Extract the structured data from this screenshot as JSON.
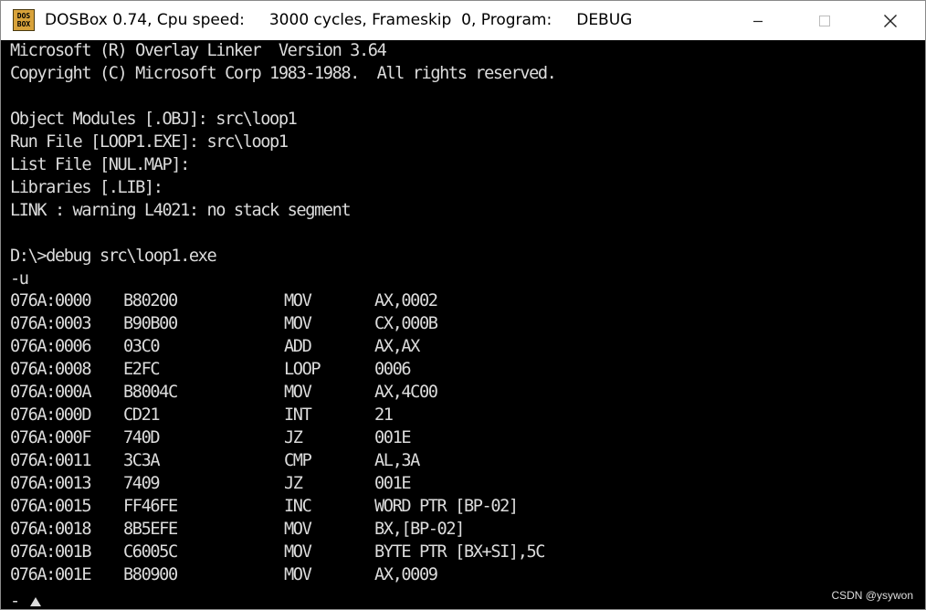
{
  "window": {
    "title": "DOSBox 0.74, Cpu speed:     3000 cycles, Frameskip  0, Program:     DEBUG",
    "icon": {
      "name": "dosbox-icon",
      "top": "DOS",
      "bottom": "BOX"
    },
    "controls": [
      "minimize",
      "maximize",
      "close"
    ]
  },
  "console": {
    "header_lines": [
      "Microsoft (R) Overlay Linker  Version 3.64",
      "Copyright (C) Microsoft Corp 1983-1988.  All rights reserved.",
      "",
      "Object Modules [.OBJ]: src\\loop1",
      "Run File [LOOP1.EXE]: src\\loop1",
      "List File [NUL.MAP]:",
      "Libraries [.LIB]:",
      "LINK : warning L4021: no stack segment",
      "",
      "D:\\>debug src\\loop1.exe",
      "-u"
    ],
    "disassembly": [
      {
        "addr": "076A:0000",
        "bytes": "B80200",
        "mnemonic": "MOV",
        "operands": "AX,0002"
      },
      {
        "addr": "076A:0003",
        "bytes": "B90B00",
        "mnemonic": "MOV",
        "operands": "CX,000B"
      },
      {
        "addr": "076A:0006",
        "bytes": "03C0",
        "mnemonic": "ADD",
        "operands": "AX,AX"
      },
      {
        "addr": "076A:0008",
        "bytes": "E2FC",
        "mnemonic": "LOOP",
        "operands": "0006"
      },
      {
        "addr": "076A:000A",
        "bytes": "B8004C",
        "mnemonic": "MOV",
        "operands": "AX,4C00"
      },
      {
        "addr": "076A:000D",
        "bytes": "CD21",
        "mnemonic": "INT",
        "operands": "21"
      },
      {
        "addr": "076A:000F",
        "bytes": "740D",
        "mnemonic": "JZ",
        "operands": "001E"
      },
      {
        "addr": "076A:0011",
        "bytes": "3C3A",
        "mnemonic": "CMP",
        "operands": "AL,3A"
      },
      {
        "addr": "076A:0013",
        "bytes": "7409",
        "mnemonic": "JZ",
        "operands": "001E"
      },
      {
        "addr": "076A:0015",
        "bytes": "FF46FE",
        "mnemonic": "INC",
        "operands": "WORD PTR [BP-02]"
      },
      {
        "addr": "076A:0018",
        "bytes": "8B5EFE",
        "mnemonic": "MOV",
        "operands": "BX,[BP-02]"
      },
      {
        "addr": "076A:001B",
        "bytes": "C6005C",
        "mnemonic": "MOV",
        "operands": "BYTE PTR [BX+SI],5C"
      },
      {
        "addr": "076A:001E",
        "bytes": "B80900",
        "mnemonic": "MOV",
        "operands": "AX,0009"
      }
    ],
    "prompt": "-"
  },
  "watermark": "CSDN @ysywon",
  "colors": {
    "console_bg": "#000000",
    "console_fg": "#dcdcdc",
    "titlebar_bg": "#ffffff",
    "icon_bg": "#d8a23a"
  }
}
